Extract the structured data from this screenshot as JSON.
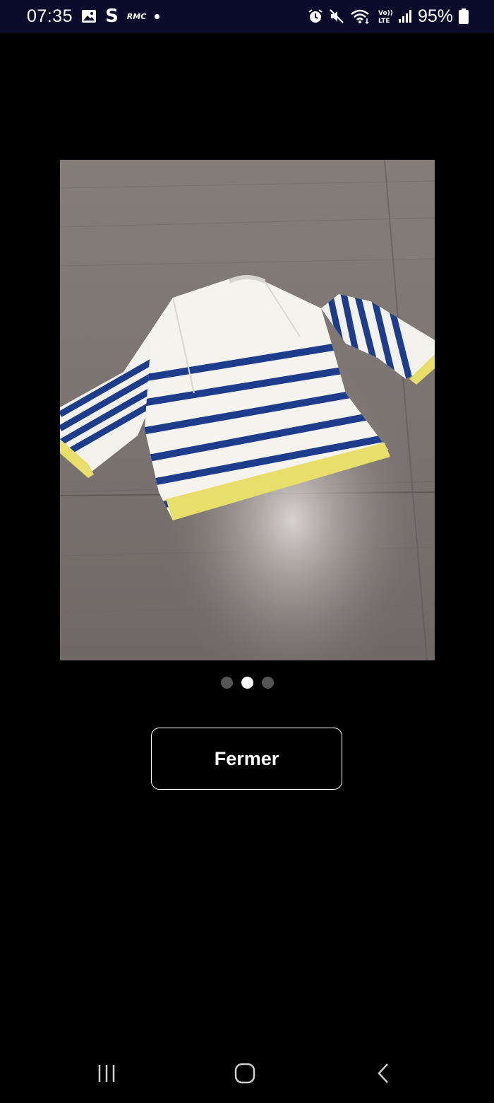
{
  "status_bar": {
    "time": "07:35",
    "s_icon": "S",
    "rmc_icon": "RMC",
    "battery_percent": "95%",
    "volte_label": "Vo)) LTE",
    "icons": [
      "gallery-icon",
      "s-app-icon",
      "rmc-icon",
      "notification-dot-icon",
      "alarm-icon",
      "mute-icon",
      "wifi-icon",
      "volte-icon",
      "signal-icon",
      "battery-icon"
    ]
  },
  "viewer": {
    "pager": {
      "count": 3,
      "active_index": 1
    },
    "close_label": "Fermer"
  },
  "nav_bar": {
    "icons": [
      "recents-icon",
      "home-icon",
      "back-icon"
    ]
  },
  "colors": {
    "status_bar_bg": "#0b0b2c",
    "background": "#000000",
    "pager_active": "#ffffff",
    "pager_inactive": "#555555",
    "stripe_navy": "#1d3c8c",
    "trim_yellow": "#e8de6a"
  }
}
